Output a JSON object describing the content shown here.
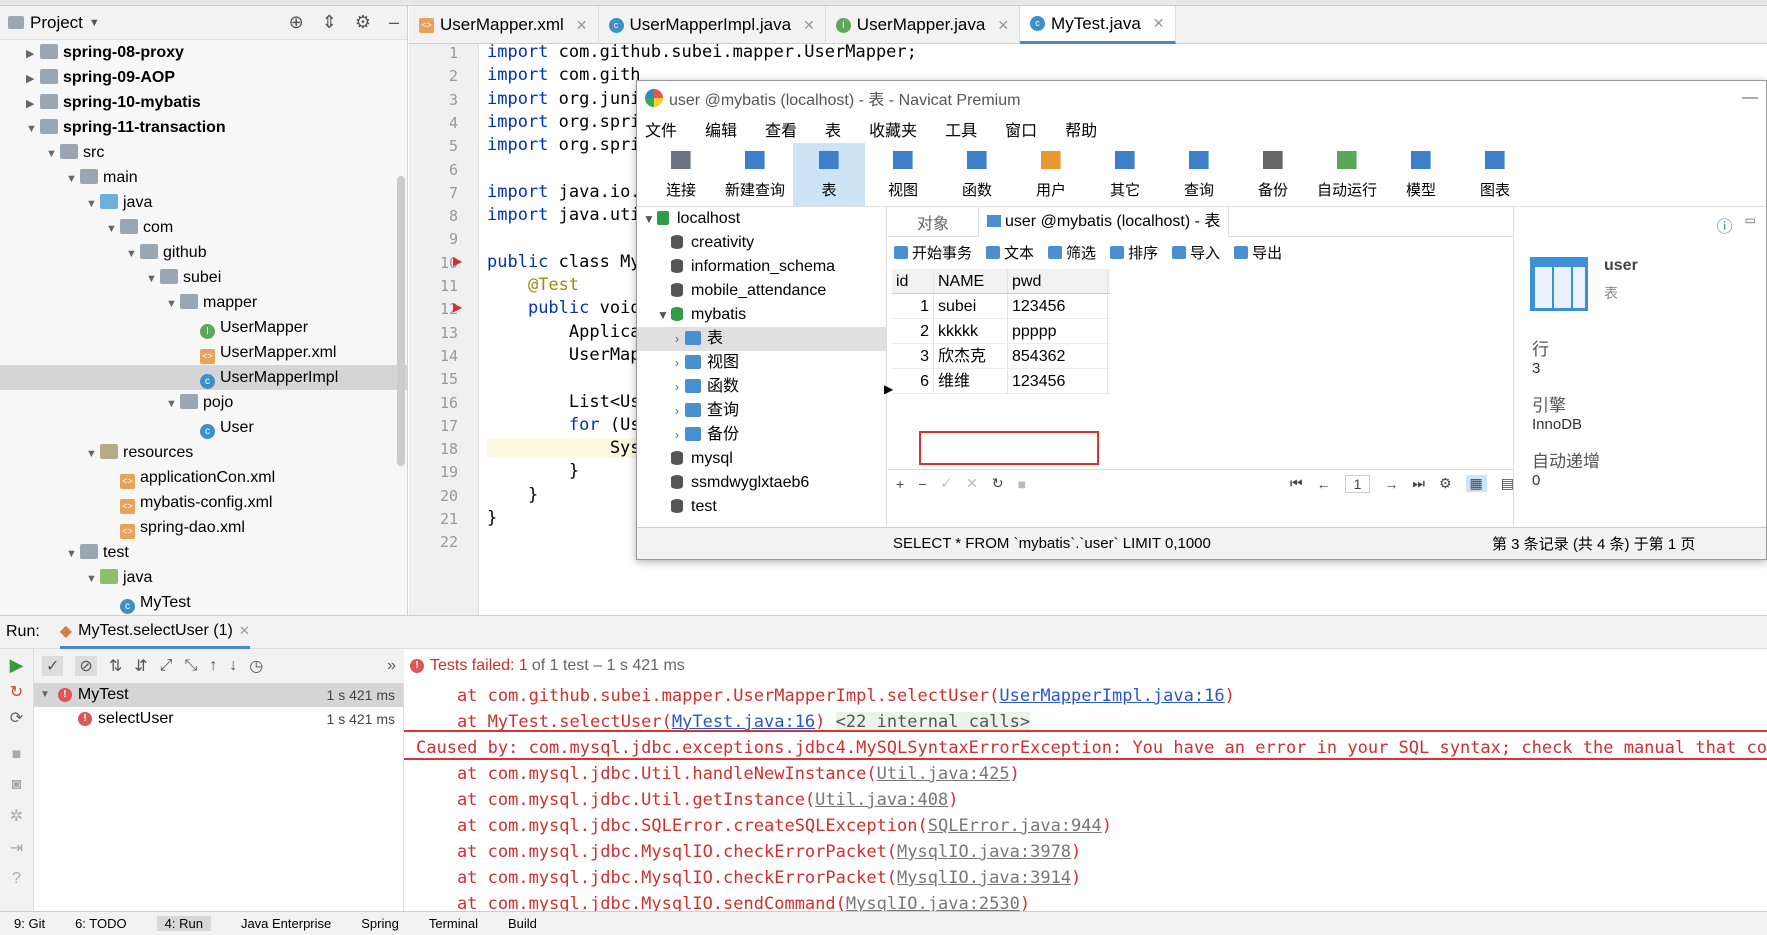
{
  "project": {
    "title": "Project",
    "tree": [
      {
        "label": "spring-08-proxy",
        "depth": 0,
        "arrow": "▶",
        "icon": "folder",
        "bold": true
      },
      {
        "label": "spring-09-AOP",
        "depth": 0,
        "arrow": "▶",
        "icon": "folder",
        "bold": true
      },
      {
        "label": "spring-10-mybatis",
        "depth": 0,
        "arrow": "▶",
        "icon": "folder",
        "bold": true
      },
      {
        "label": "spring-11-transaction",
        "depth": 0,
        "arrow": "▼",
        "icon": "folder",
        "bold": true
      },
      {
        "label": "src",
        "depth": 1,
        "arrow": "▼",
        "icon": "folder"
      },
      {
        "label": "main",
        "depth": 2,
        "arrow": "▼",
        "icon": "folder"
      },
      {
        "label": "java",
        "depth": 3,
        "arrow": "▼",
        "icon": "bluef"
      },
      {
        "label": "com",
        "depth": 4,
        "arrow": "▼",
        "icon": "folder"
      },
      {
        "label": "github",
        "depth": 5,
        "arrow": "▼",
        "icon": "folder"
      },
      {
        "label": "subei",
        "depth": 6,
        "arrow": "▼",
        "icon": "folder"
      },
      {
        "label": "mapper",
        "depth": 7,
        "arrow": "▼",
        "icon": "folder"
      },
      {
        "label": "UserMapper",
        "depth": 8,
        "arrow": "",
        "icon": "intf"
      },
      {
        "label": "UserMapper.xml",
        "depth": 8,
        "arrow": "",
        "icon": "xml"
      },
      {
        "label": "UserMapperImpl",
        "depth": 8,
        "arrow": "",
        "icon": "cls",
        "selected": true
      },
      {
        "label": "pojo",
        "depth": 7,
        "arrow": "▼",
        "icon": "folder"
      },
      {
        "label": "User",
        "depth": 8,
        "arrow": "",
        "icon": "cls"
      },
      {
        "label": "resources",
        "depth": 3,
        "arrow": "▼",
        "icon": "res"
      },
      {
        "label": "applicationCon.xml",
        "depth": 4,
        "arrow": "",
        "icon": "xml"
      },
      {
        "label": "mybatis-config.xml",
        "depth": 4,
        "arrow": "",
        "icon": "xml"
      },
      {
        "label": "spring-dao.xml",
        "depth": 4,
        "arrow": "",
        "icon": "xml"
      },
      {
        "label": "test",
        "depth": 2,
        "arrow": "▼",
        "icon": "folder"
      },
      {
        "label": "java",
        "depth": 3,
        "arrow": "▼",
        "icon": "testf"
      },
      {
        "label": "MyTest",
        "depth": 4,
        "arrow": "",
        "icon": "cls"
      }
    ]
  },
  "editor": {
    "tabs": [
      {
        "label": "UserMapper.xml",
        "icon": "xml"
      },
      {
        "label": "UserMapperImpl.java",
        "icon": "cls"
      },
      {
        "label": "UserMapper.java",
        "icon": "intf"
      },
      {
        "label": "MyTest.java",
        "icon": "cls",
        "active": true
      }
    ],
    "lines": [
      {
        "n": "1",
        "code": "import com.github.subei.mapper.UserMapper;"
      },
      {
        "n": "2",
        "code": "import com.gith"
      },
      {
        "n": "3",
        "code": "import org.juni"
      },
      {
        "n": "4",
        "code": "import org.spri"
      },
      {
        "n": "5",
        "code": "import org.spri"
      },
      {
        "n": "6",
        "code": ""
      },
      {
        "n": "7",
        "code": "import java.io."
      },
      {
        "n": "8",
        "code": "import java.uti"
      },
      {
        "n": "9",
        "code": ""
      },
      {
        "n": "10",
        "code": "public class My"
      },
      {
        "n": "11",
        "code": "    @Test"
      },
      {
        "n": "12",
        "code": "    public void"
      },
      {
        "n": "13",
        "code": "        Applica"
      },
      {
        "n": "14",
        "code": "        UserMap"
      },
      {
        "n": "15",
        "code": ""
      },
      {
        "n": "16",
        "code": "        List<Us"
      },
      {
        "n": "17",
        "code": "        for (Us"
      },
      {
        "n": "18",
        "code": "            Sys"
      },
      {
        "n": "19",
        "code": "        }"
      },
      {
        "n": "20",
        "code": "    }"
      },
      {
        "n": "21",
        "code": "}"
      },
      {
        "n": "22",
        "code": ""
      }
    ]
  },
  "navicat": {
    "title": "user @mybatis (localhost) - 表 - Navicat Premium",
    "menu": [
      "文件",
      "编辑",
      "查看",
      "表",
      "收藏夹",
      "工具",
      "窗口",
      "帮助"
    ],
    "toolbar": [
      "连接",
      "新建查询",
      "表",
      "视图",
      "函数",
      "用户",
      "其它",
      "查询",
      "备份",
      "自动运行",
      "模型",
      "图表"
    ],
    "toolbar_active": "表",
    "tree": [
      {
        "label": "localhost",
        "type": "conn",
        "car": "▼",
        "indent": 0
      },
      {
        "label": "creativity",
        "type": "db",
        "car": "",
        "indent": 1
      },
      {
        "label": "information_schema",
        "type": "db",
        "car": "",
        "indent": 1
      },
      {
        "label": "mobile_attendance",
        "type": "db",
        "car": "",
        "indent": 1
      },
      {
        "label": "mybatis",
        "type": "dbgreen",
        "car": "▼",
        "indent": 1
      },
      {
        "label": "表",
        "type": "sub",
        "car": "›",
        "indent": 2,
        "selected": true
      },
      {
        "label": "视图",
        "type": "sub",
        "car": "›",
        "indent": 2
      },
      {
        "label": "函数",
        "type": "sub",
        "car": "›",
        "indent": 2
      },
      {
        "label": "查询",
        "type": "sub",
        "car": "›",
        "indent": 2
      },
      {
        "label": "备份",
        "type": "sub",
        "car": "›",
        "indent": 2
      },
      {
        "label": "mysql",
        "type": "db",
        "car": "",
        "indent": 1
      },
      {
        "label": "ssmdwyglxtaeb6",
        "type": "db",
        "car": "",
        "indent": 1
      },
      {
        "label": "test",
        "type": "db",
        "car": "",
        "indent": 1
      }
    ],
    "tabs": {
      "objects": "对象",
      "table": "user @mybatis (localhost) - 表"
    },
    "actions": [
      "开始事务",
      "文本",
      "筛选",
      "排序",
      "导入",
      "导出"
    ],
    "grid": {
      "columns": [
        "id",
        "NAME",
        "pwd"
      ],
      "rows": [
        [
          "1",
          "subei",
          "123456"
        ],
        [
          "2",
          "kkkkk",
          "ppppp"
        ],
        [
          "3",
          "欣杰克",
          "854362"
        ],
        [
          "6",
          "维维",
          "123456"
        ]
      ]
    },
    "page": "1",
    "status_sql": "SELECT * FROM `mybatis`.`user` LIMIT 0,1000",
    "status_records": "第 3 条记录 (共 4 条) 于第 1 页",
    "info": {
      "name": "user",
      "type": "表",
      "rows_label": "行",
      "rows_value": "3",
      "engine_label": "引擎",
      "engine_value": "InnoDB",
      "auto_label": "自动递增",
      "auto_value": "0"
    }
  },
  "run": {
    "label": "Run:",
    "config": "MyTest.selectUser (1)",
    "status_fail": "Tests failed: 1",
    "status_rest": "of 1 test – 1 s 421 ms",
    "tree": [
      {
        "label": "MyTest",
        "time": "1 s 421 ms",
        "selected": true
      },
      {
        "label": "selectUser",
        "time": "1 s 421 ms"
      }
    ],
    "console": [
      {
        "pre": "    at com.github.subei.mapper.UserMapperImpl.selectUser(",
        "link": "UserMapperImpl.java:16",
        "post": ")",
        "style": "lk"
      },
      {
        "pre": "    at MyTest.selectUser(",
        "link": "MyTest.java:16",
        "post": ") ",
        "extra": "<22 internal calls>",
        "style": "lk"
      },
      {
        "pre": "Caused by: com.mysql.jdbc.exceptions.jdbc4.MySQLSyntaxErrorException: You have an error in your SQL syntax; check the manual that corre",
        "link": "",
        "post": "",
        "style": ""
      },
      {
        "pre": "    at com.mysql.jdbc.Util.handleNewInstance(",
        "link": "Util.java:425",
        "post": ")",
        "style": "lk2"
      },
      {
        "pre": "    at com.mysql.jdbc.Util.getInstance(",
        "link": "Util.java:408",
        "post": ")",
        "style": "lk2"
      },
      {
        "pre": "    at com.mysql.jdbc.SQLError.createSQLException(",
        "link": "SQLError.java:944",
        "post": ")",
        "style": "lk2"
      },
      {
        "pre": "    at com.mysql.jdbc.MysqlIO.checkErrorPacket(",
        "link": "MysqlIO.java:3978",
        "post": ")",
        "style": "lk2"
      },
      {
        "pre": "    at com.mysql.jdbc.MysqlIO.checkErrorPacket(",
        "link": "MysqlIO.java:3914",
        "post": ")",
        "style": "lk2"
      },
      {
        "pre": "    at com.mysql.jdbc.MysqlIO.sendCommand(",
        "link": "MysqlIO.java:2530",
        "post": ")",
        "style": "lk2"
      }
    ]
  },
  "bottom_bar": [
    "9: Git",
    "6: TODO",
    "4: Run",
    "Java Enterprise",
    "Spring",
    "Terminal",
    "Build"
  ],
  "bottom_active": "4: Run"
}
